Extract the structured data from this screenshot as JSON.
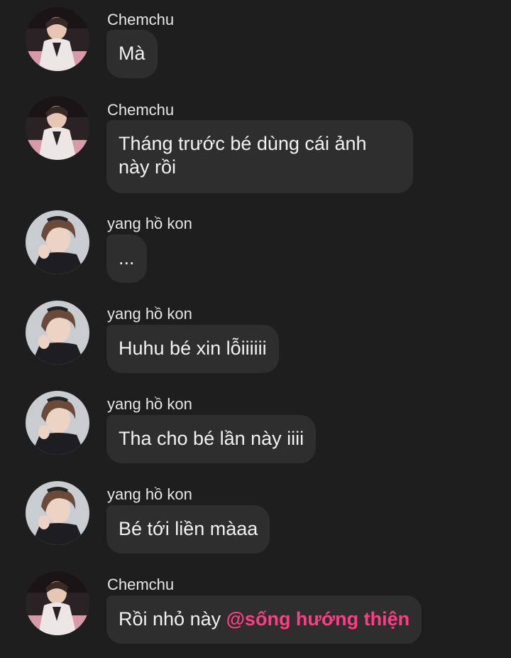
{
  "conversation": {
    "messages": [
      {
        "sender": "Chemchu",
        "avatar": "chemchu-avatar",
        "text": "Mà"
      },
      {
        "sender": "Chemchu",
        "avatar": "chemchu-avatar",
        "text": "Tháng trước bé dùng cái ảnh này rồi"
      },
      {
        "sender": "yang hồ kon",
        "avatar": "yang-avatar",
        "text": "..."
      },
      {
        "sender": "yang hồ kon",
        "avatar": "yang-avatar",
        "text": "Huhu bé xin lỗiiiiii"
      },
      {
        "sender": "yang hồ kon",
        "avatar": "yang-avatar",
        "text": "Tha cho bé lần này iiii"
      },
      {
        "sender": "yang hồ kon",
        "avatar": "yang-avatar",
        "text": "Bé tới liền màaa"
      },
      {
        "sender": "Chemchu",
        "avatar": "chemchu-avatar",
        "text": "Rồi nhỏ này ",
        "mention": "@sống hướng thiện"
      }
    ]
  },
  "colors": {
    "background": "#1e1e1e",
    "bubble": "#2e2e2e",
    "text": "#f2f2f2",
    "mention": "#ff3d87"
  }
}
